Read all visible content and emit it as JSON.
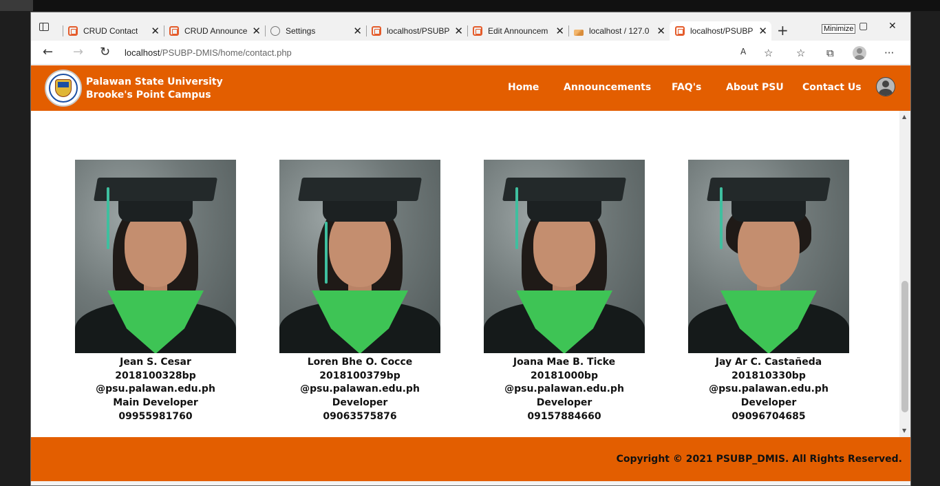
{
  "browser": {
    "tabs": [
      {
        "label": "CRUD Contact",
        "icon": "xampp-icon"
      },
      {
        "label": "CRUD Announce",
        "icon": "xampp-icon"
      },
      {
        "label": "Settings",
        "icon": "gear-icon"
      },
      {
        "label": "localhost/PSUBP",
        "icon": "xampp-icon"
      },
      {
        "label": "Edit Announcem",
        "icon": "xampp-icon"
      },
      {
        "label": "localhost / 127.0",
        "icon": "phpmyadmin-icon"
      },
      {
        "label": "localhost/PSUBP",
        "icon": "xampp-icon",
        "active": true
      }
    ],
    "tooltip": "Minimize",
    "url_host": "localhost",
    "url_path": "/PSUBP-DMIS/home/contact.php"
  },
  "site": {
    "brand_line1": "Palawan State University",
    "brand_line2": "Brooke's Point Campus",
    "nav": [
      "Home",
      "Announcements",
      "FAQ's",
      "About PSU",
      "Contact Us"
    ],
    "accent_color": "#e35e00"
  },
  "members": [
    {
      "name": "Jean S. Cesar",
      "id": "2018100328bp",
      "email": "@psu.palawan.edu.ph",
      "role": "Main Developer",
      "phone": "09955981760"
    },
    {
      "name": "Loren Bhe O. Cocce",
      "id": "2018100379bp",
      "email": "@psu.palawan.edu.ph",
      "role": "Developer",
      "phone": "09063575876"
    },
    {
      "name": "Joana Mae B. Ticke",
      "id": "20181000bp",
      "email": "@psu.palawan.edu.ph",
      "role": "Developer",
      "phone": "09157884660"
    },
    {
      "name": "Jay Ar C. Castañeda",
      "id": "201810330bp",
      "email": "@psu.palawan.edu.ph",
      "role": "Developer",
      "phone": "09096704685"
    }
  ],
  "footer": {
    "copyright": "Copyright © 2021 PSUBP_DMIS. All Rights Reserved."
  }
}
